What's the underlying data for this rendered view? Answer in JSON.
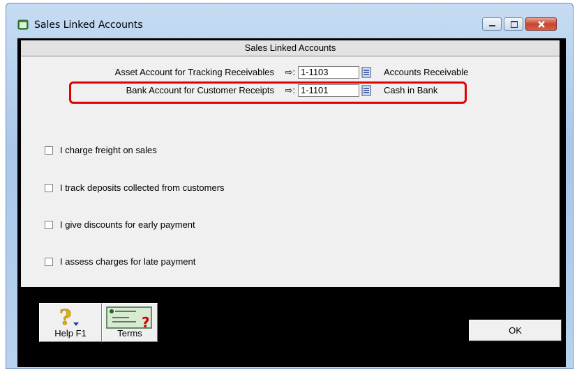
{
  "window": {
    "title": "Sales Linked Accounts"
  },
  "section": {
    "header": "Sales Linked Accounts"
  },
  "linked_accounts": [
    {
      "label": "Asset Account for Tracking Receivables",
      "arrow": "⇨:",
      "account_number": "1-1103",
      "account_name": "Accounts Receivable"
    },
    {
      "label": "Bank Account for Customer Receipts",
      "arrow": "⇨:",
      "account_number": "1-1101",
      "account_name": "Cash in Bank"
    }
  ],
  "options": [
    {
      "label": "I charge freight on sales",
      "checked": false
    },
    {
      "label": "I track deposits collected from customers",
      "checked": false
    },
    {
      "label": "I give discounts for early payment",
      "checked": false
    },
    {
      "label": "I assess charges for late payment",
      "checked": false
    }
  ],
  "toolbar": {
    "help_label": "Help F1",
    "terms_label": "Terms"
  },
  "ok_label": "OK",
  "colors": {
    "highlight": "#e00000",
    "panel": "#f0f0f0",
    "frame": "#000000"
  }
}
